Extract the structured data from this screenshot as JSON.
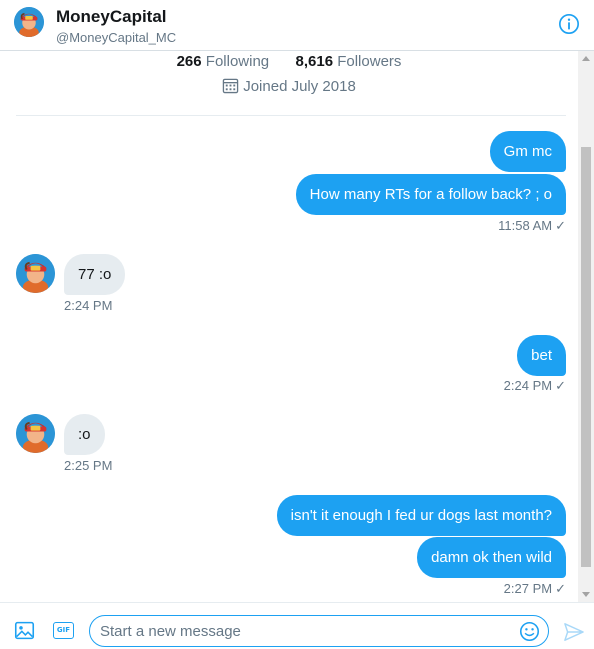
{
  "header": {
    "name": "MoneyCapital",
    "handle": "@MoneyCapital_MC",
    "avatar_icon": "avatar-cartoon",
    "info_icon": "info-icon"
  },
  "profile": {
    "following_count": "266",
    "following_label": "Following",
    "followers_count": "8,616",
    "followers_label": "Followers",
    "joined": "Joined July 2018"
  },
  "messages": [
    {
      "direction": "out",
      "text": "Gm mc"
    },
    {
      "direction": "out",
      "text": "How many RTs for a follow back?   ;  o",
      "time": "11:58 AM",
      "read": "✓"
    },
    {
      "direction": "in",
      "text": "77 :o",
      "time": "2:24 PM"
    },
    {
      "direction": "out",
      "text": "bet",
      "time": "2:24 PM",
      "read": "✓"
    },
    {
      "direction": "in",
      "text": ":o",
      "time": "2:25 PM"
    },
    {
      "direction": "out",
      "text": "isn't it enough I fed ur dogs last month?"
    },
    {
      "direction": "out",
      "text": "damn ok then wild",
      "time": "2:27 PM",
      "read": "✓"
    }
  ],
  "composer": {
    "placeholder": "Start a new message",
    "gif_label": "GIF"
  },
  "colors": {
    "accent": "#1da1f2",
    "incoming_bubble": "#e6ecf0",
    "secondary_text": "#657786"
  }
}
